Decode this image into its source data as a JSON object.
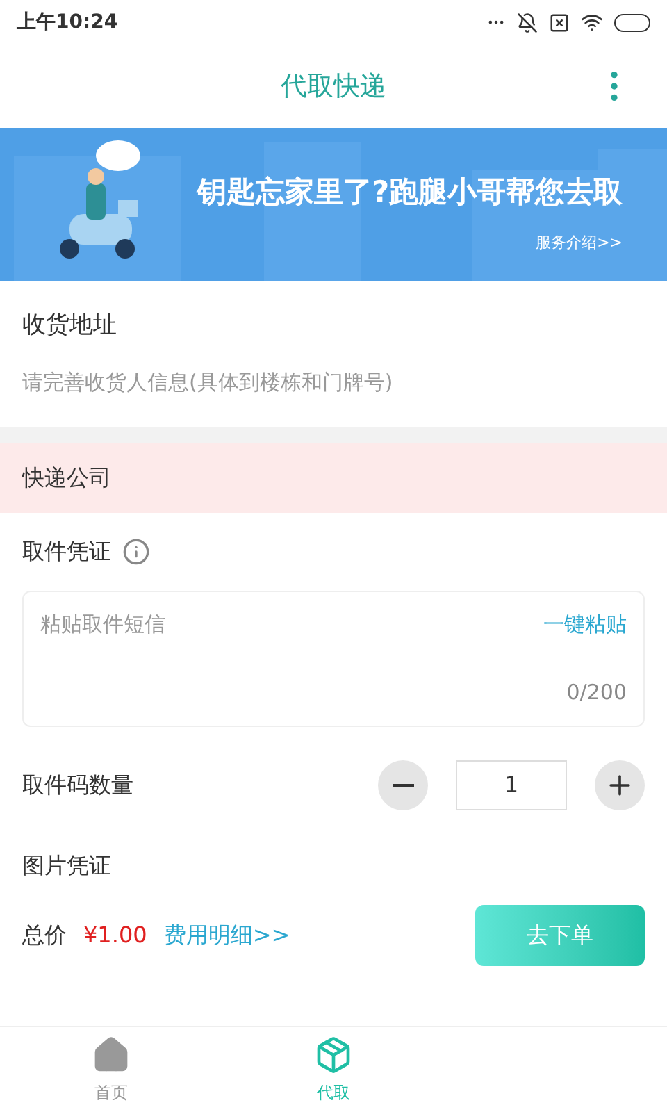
{
  "status_bar": {
    "time": "上午10:24"
  },
  "header": {
    "title": "代取快递"
  },
  "banner": {
    "kind": "picture",
    "headline": "钥匙忘家里了?跑腿小哥帮您去取",
    "link": "服务介绍>>"
  },
  "address": {
    "label": "收货地址",
    "placeholder": "请完善收货人信息(具体到楼栋和门牌号)"
  },
  "courier": {
    "label": "快递公司",
    "highlighted": true
  },
  "proof": {
    "label": "取件凭证",
    "placeholder": "粘贴取件短信",
    "paste_button": "一键粘贴",
    "counter": "0/200"
  },
  "quantity": {
    "label": "取件码数量",
    "value": "1"
  },
  "images": {
    "label": "图片凭证"
  },
  "footer": {
    "total_label": "总价",
    "price": "¥1.00",
    "details_link": "费用明细>>",
    "submit": "去下单"
  },
  "tabs": [
    {
      "label": "首页",
      "selected": false
    },
    {
      "label": "代取",
      "selected": true
    }
  ]
}
